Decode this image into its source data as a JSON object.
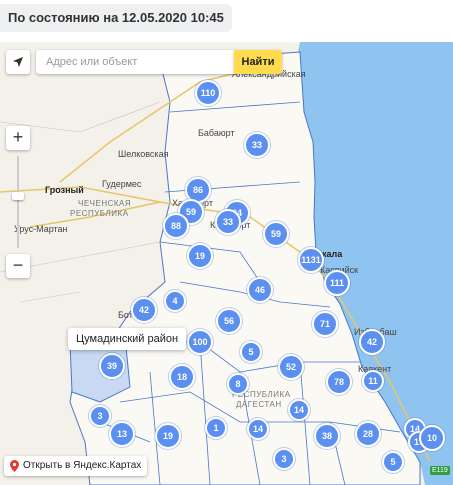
{
  "status": "По состоянию на 12.05.2020 10:45",
  "search": {
    "placeholder": "Адрес или объект",
    "button": "Найти"
  },
  "zoom": {
    "plus": "+",
    "minus": "−"
  },
  "tooltip": "Цумадинский район",
  "open_link": "Открыть в Яндекс.Картах",
  "map_labels": {
    "alexandriyskaya": "Александрийская",
    "babayurt": "Бабаюрт",
    "shelkovskaya": "Шелковская",
    "gudermes": "Гудермес",
    "grozny": "Грозный",
    "chechnya1": "ЧЕЧЕНСКАЯ",
    "chechnya2": "РЕСПУБЛИКА",
    "urus_martan": "Урус-Мартан",
    "khasavyurt": "Хасавюрт",
    "kizilyurt": "Кизилюрт",
    "makhachkala": "кала",
    "kaspiysk": "Каспийск",
    "izberbash": "Избербаш",
    "kayakent": "Каякент",
    "dagestan1": "РЕСПУБЛИКА",
    "dagestan2": "ДАГЕСТАН",
    "botlikh": "Бот",
    "road": "E119"
  },
  "clusters": [
    {
      "v": "110"
    },
    {
      "v": "33"
    },
    {
      "v": "86"
    },
    {
      "v": "59"
    },
    {
      "v": "24"
    },
    {
      "v": "88"
    },
    {
      "v": "33"
    },
    {
      "v": "59"
    },
    {
      "v": "19"
    },
    {
      "v": "1131"
    },
    {
      "v": "111"
    },
    {
      "v": "46"
    },
    {
      "v": "4"
    },
    {
      "v": "42"
    },
    {
      "v": "56"
    },
    {
      "v": "71"
    },
    {
      "v": "100"
    },
    {
      "v": "42"
    },
    {
      "v": "39"
    },
    {
      "v": "5"
    },
    {
      "v": "52"
    },
    {
      "v": "18"
    },
    {
      "v": "78"
    },
    {
      "v": "11"
    },
    {
      "v": "8"
    },
    {
      "v": "3"
    },
    {
      "v": "14"
    },
    {
      "v": "13"
    },
    {
      "v": "19"
    },
    {
      "v": "1"
    },
    {
      "v": "14"
    },
    {
      "v": "38"
    },
    {
      "v": "28"
    },
    {
      "v": "14"
    },
    {
      "v": "19"
    },
    {
      "v": "10"
    },
    {
      "v": "3"
    },
    {
      "v": "5"
    }
  ],
  "colors": {
    "cluster": "#5b8ff0",
    "sea": "#8fc3f0",
    "land": "#f4f1ea",
    "button": "#ffdb4d"
  }
}
